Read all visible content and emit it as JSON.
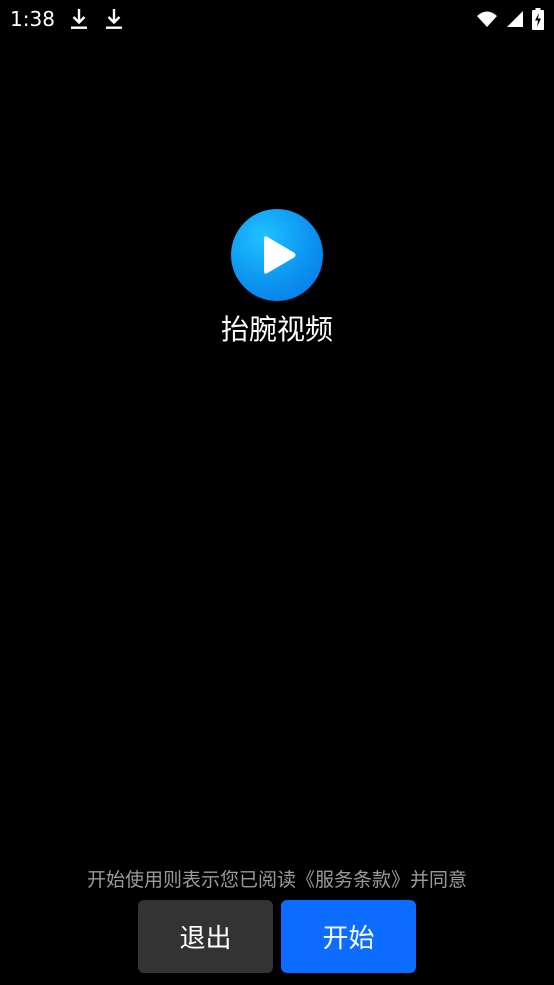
{
  "status_bar": {
    "time": "1:38",
    "icons": [
      "download-icon",
      "download-icon",
      "wifi-icon",
      "cellular-signal-icon",
      "battery-charging-icon"
    ]
  },
  "app": {
    "name": "抬腕视频",
    "logo_icon": "play-icon",
    "logo_colors": [
      "#1fc2ff",
      "#0673e6"
    ]
  },
  "footer": {
    "terms_text": "开始使用则表示您已阅读《服务条款》并同意",
    "exit_label": "退出",
    "start_label": "开始"
  },
  "colors": {
    "background": "#000000",
    "exit_button": "#333333",
    "start_button": "#0b6cff",
    "terms_text": "#9a9a9a"
  }
}
